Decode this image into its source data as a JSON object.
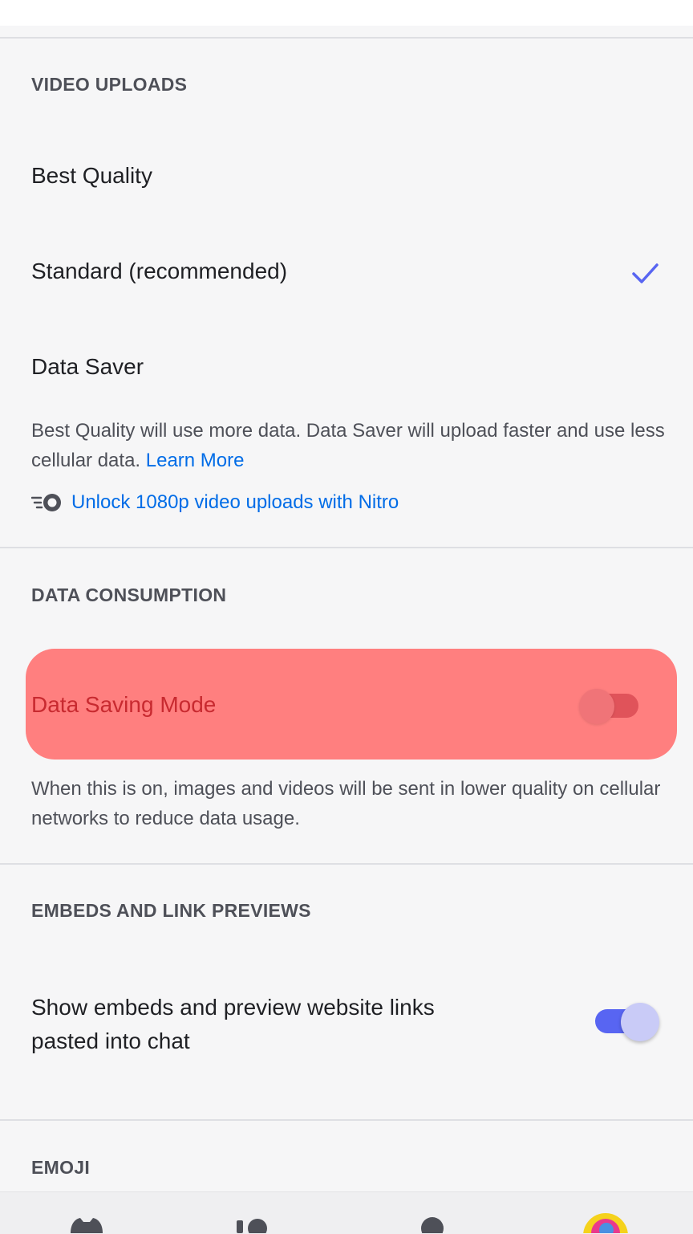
{
  "sections": {
    "video_uploads": {
      "header": "VIDEO UPLOADS",
      "options": [
        {
          "label": "Best Quality",
          "selected": false
        },
        {
          "label": "Standard (recommended)",
          "selected": true
        },
        {
          "label": "Data Saver",
          "selected": false
        }
      ],
      "description": "Best Quality will use more data. Data Saver will upload faster and use less cellular data.",
      "learn_more": "Learn More",
      "nitro_link": "Unlock 1080p video uploads with Nitro"
    },
    "data_consumption": {
      "header": "DATA CONSUMPTION",
      "toggle_label": "Data Saving Mode",
      "toggle_on": false,
      "description": "When this is on, images and videos will be sent in lower quality on cellular networks to reduce data usage."
    },
    "embeds": {
      "header": "EMBEDS AND LINK PREVIEWS",
      "toggle_label_line1": "Show embeds and preview website links",
      "toggle_label_line2": "pasted into chat",
      "toggle_on": true
    },
    "emoji": {
      "header": "EMOJI"
    }
  },
  "colors": {
    "accent": "#5865f2",
    "link": "#006ce7",
    "highlight": "#ff7f7f"
  },
  "icons": {
    "check": "checkmark-icon",
    "nitro": "nitro-icon",
    "nav": [
      "home-icon",
      "calls-icon",
      "profile-icon",
      "avatar-icon"
    ]
  }
}
